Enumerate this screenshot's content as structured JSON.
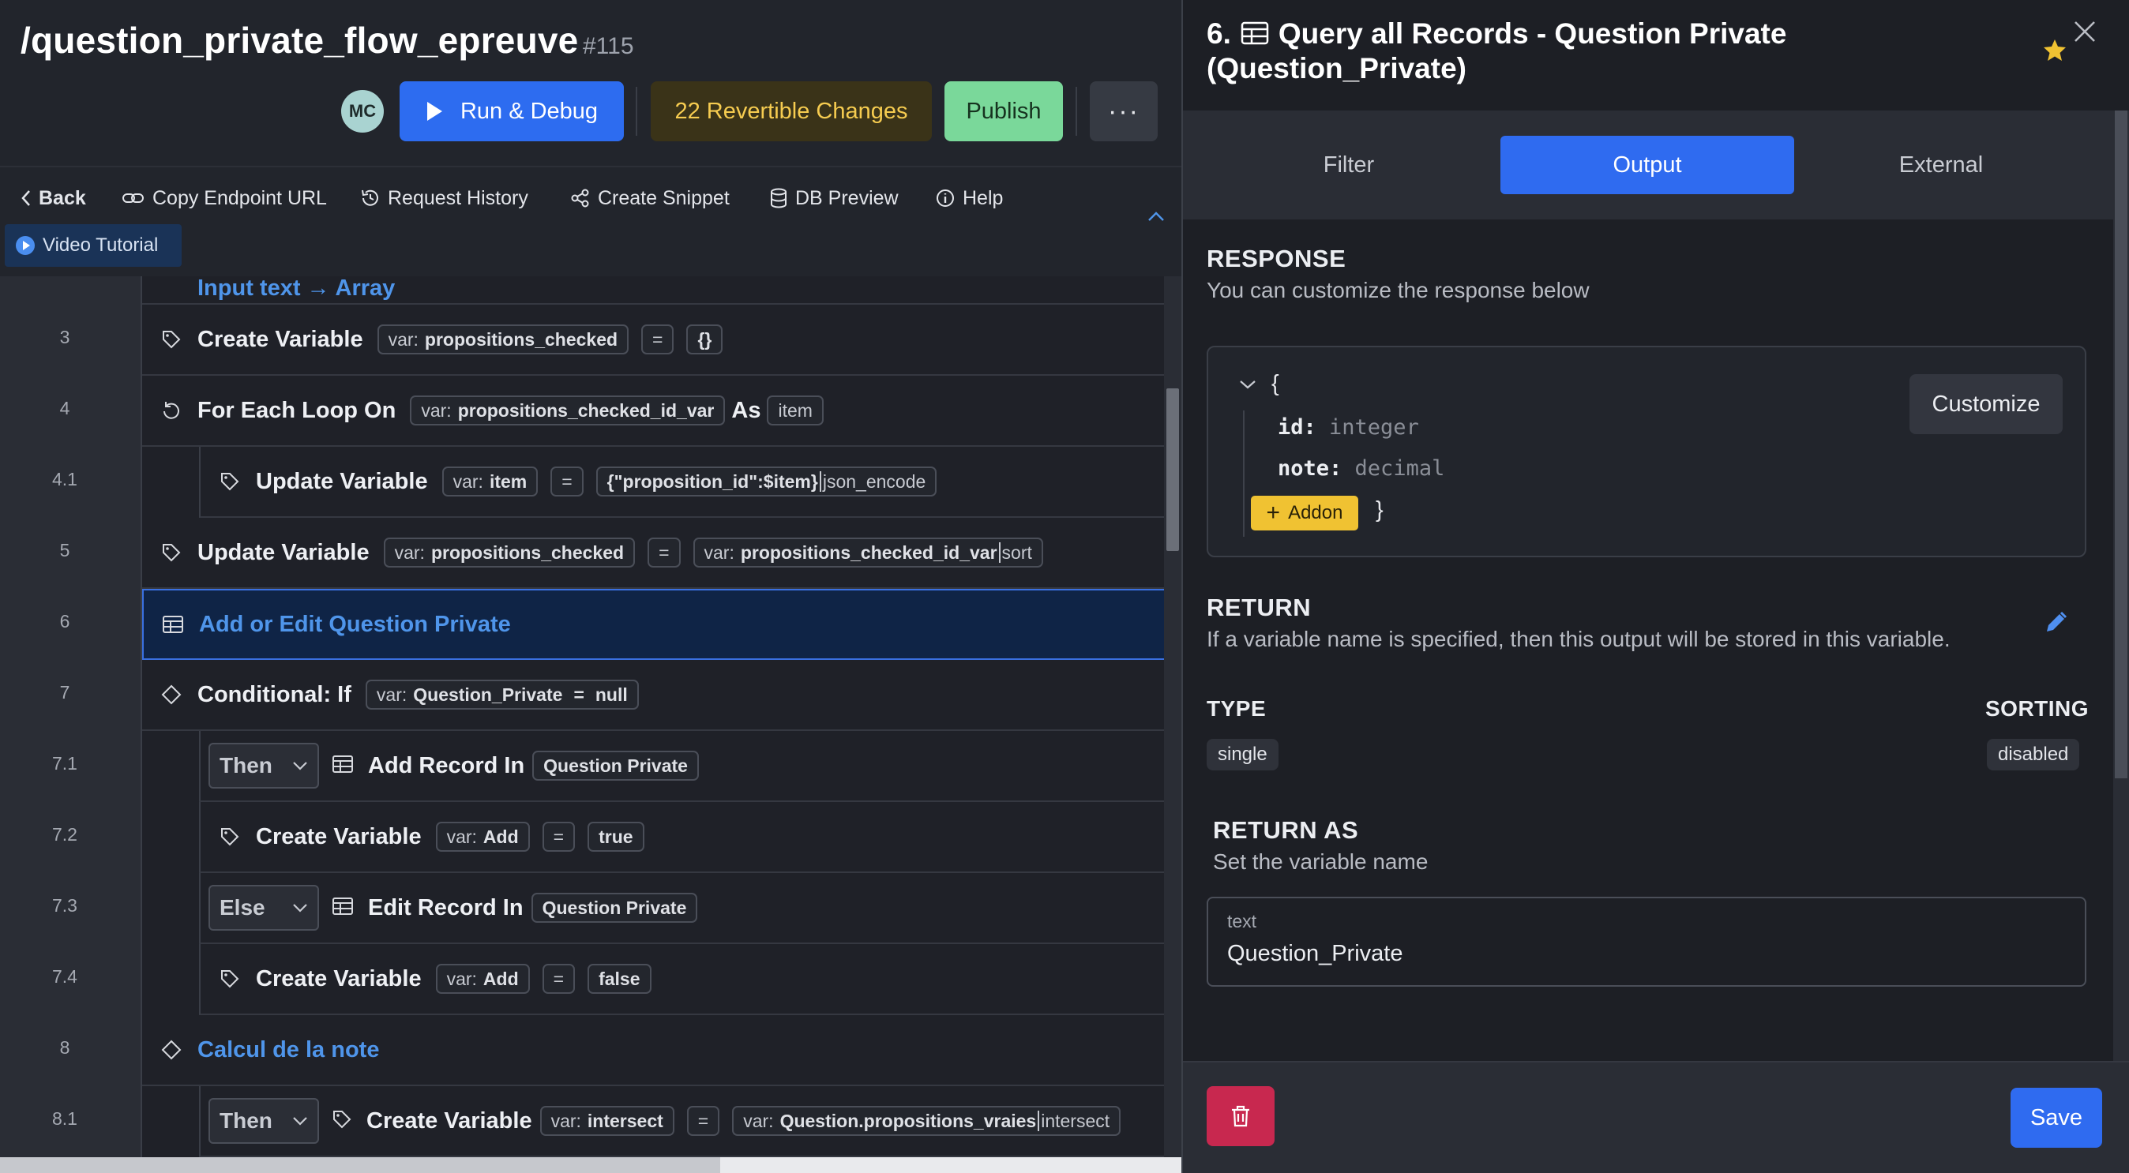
{
  "header": {
    "title": "/question_private_flow_epreuve",
    "id_label": "#115",
    "avatar_initials": "MC",
    "run_label": "Run & Debug",
    "changes_label": "22 Revertible Changes",
    "publish_label": "Publish",
    "more_label": "···"
  },
  "toolbar": {
    "back": "Back",
    "copy_endpoint": "Copy Endpoint URL",
    "request_history": "Request History",
    "create_snippet": "Create Snippet",
    "db_preview": "DB Preview",
    "help": "Help",
    "video_tutorial": "Video Tutorial"
  },
  "steps": {
    "partial_label": "Input text → Array",
    "s3": {
      "no": "3",
      "label": "Create Variable",
      "var_prefix": "var:",
      "var": "propositions_checked",
      "eq": "=",
      "value": "{}"
    },
    "s4": {
      "no": "4",
      "label": "For Each Loop On",
      "var_prefix": "var:",
      "var": "propositions_checked_id_var",
      "as": "As",
      "item": "item"
    },
    "s41": {
      "no": "4.1",
      "label": "Update Variable",
      "var_prefix": "var:",
      "var": "item",
      "eq": "=",
      "value": "{\"proposition_id\":$item}",
      "filter": "json_encode"
    },
    "s5": {
      "no": "5",
      "label": "Update Variable",
      "var_prefix": "var:",
      "var": "propositions_checked",
      "eq": "=",
      "value_prefix": "var:",
      "value": "propositions_checked_id_var",
      "filter": "sort"
    },
    "s6": {
      "no": "6",
      "label": "Add or Edit Question Private"
    },
    "s7": {
      "no": "7",
      "label": "Conditional: If",
      "var_prefix": "var:",
      "var": "Question_Private",
      "eq": "=",
      "value": "null"
    },
    "s71": {
      "no": "7.1",
      "branch": "Then",
      "label": "Add Record In",
      "table": "Question Private"
    },
    "s72": {
      "no": "7.2",
      "label": "Create Variable",
      "var_prefix": "var:",
      "var": "Add",
      "eq": "=",
      "value": "true"
    },
    "s73": {
      "no": "7.3",
      "branch": "Else",
      "label": "Edit Record In",
      "table": "Question Private"
    },
    "s74": {
      "no": "7.4",
      "label": "Create Variable",
      "var_prefix": "var:",
      "var": "Add",
      "eq": "=",
      "value": "false"
    },
    "s8": {
      "no": "8",
      "label": "Calcul de la note"
    },
    "s81": {
      "no": "8.1",
      "branch": "Then",
      "label": "Create Variable",
      "var_prefix": "var:",
      "var": "intersect",
      "eq": "=",
      "value_prefix": "var:",
      "value": "Question.propositions_vraies",
      "filter": "intersect"
    }
  },
  "panel": {
    "step_no": "6.",
    "title": "Query all Records - Question Private (Question_Private)",
    "tabs": [
      "Filter",
      "Output",
      "External"
    ],
    "active_tab": "Output",
    "response_heading": "RESPONSE",
    "response_sub": "You can customize the response below",
    "open_brace": "{",
    "close_brace": "}",
    "fields": [
      {
        "name": "id",
        "type": "integer"
      },
      {
        "name": "note",
        "type": "decimal"
      }
    ],
    "addon_label": "Addon",
    "customize_label": "Customize",
    "return_heading": "RETURN",
    "return_sub": "If a variable name is specified, then this output will be stored in this variable.",
    "type_heading": "TYPE",
    "type_value": "single",
    "sorting_heading": "SORTING",
    "sorting_value": "disabled",
    "return_as_heading": "RETURN AS",
    "return_as_sub": "Set the variable name",
    "input_caption": "text",
    "input_value": "Question_Private",
    "save_label": "Save"
  },
  "colors": {
    "accent": "#2f6bf0",
    "publish": "#7ad89a",
    "changes_text": "#f6cc50",
    "delete": "#c8284f",
    "addon": "#f0c232",
    "selected_row": "#0f2446"
  }
}
